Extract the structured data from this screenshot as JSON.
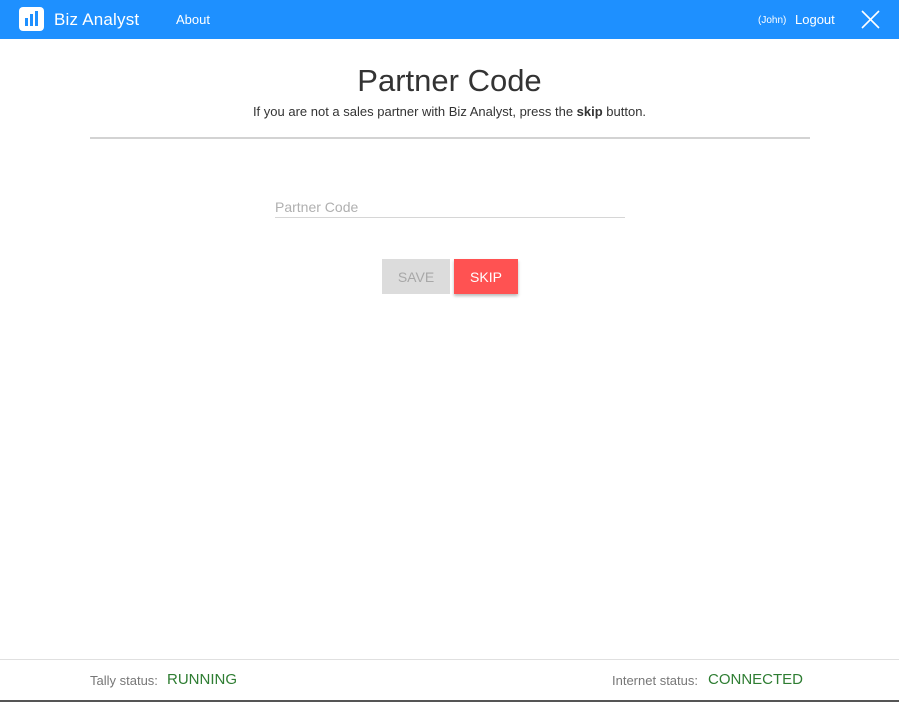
{
  "header": {
    "brand": "Biz Analyst",
    "about_label": "About",
    "user": "(John)",
    "logout_label": "Logout",
    "logo_icon": "bar-chart-icon",
    "close_icon": "close-icon",
    "color": "#1e90ff"
  },
  "main": {
    "title": "Partner Code",
    "subtitle_before": "If you are not a sales partner with Biz Analyst, press the ",
    "subtitle_bold": "skip",
    "subtitle_after": " button.",
    "partner_code_placeholder": "Partner Code",
    "partner_code_value": "",
    "save_label": "Save",
    "skip_label": "Skip",
    "skip_color": "#ff5252"
  },
  "footer": {
    "tally_label": "Tally status:",
    "tally_value": "RUNNING",
    "internet_label": "Internet status:",
    "internet_value": "CONNECTED",
    "status_color": "#2e7d32"
  }
}
